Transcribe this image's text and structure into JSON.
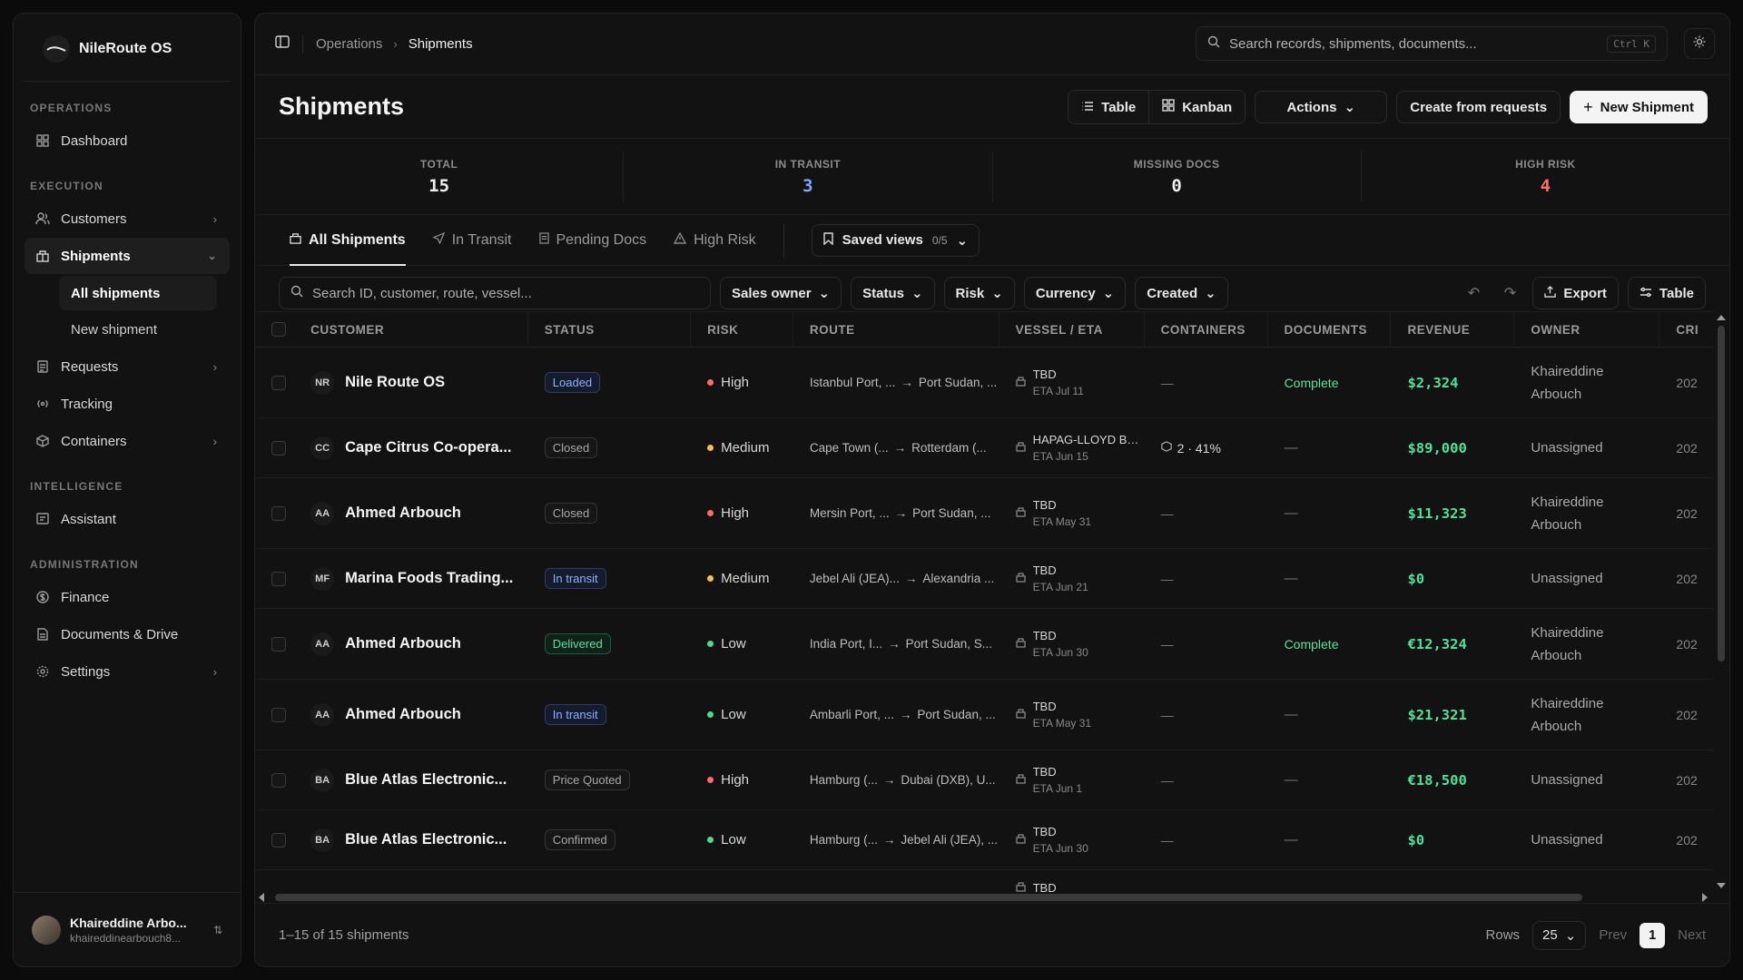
{
  "app": {
    "name": "NileRoute OS"
  },
  "sidebar": {
    "sections": {
      "operations": "OPERATIONS",
      "execution": "EXECUTION",
      "intelligence": "INTELLIGENCE",
      "administration": "ADMINISTRATION"
    },
    "items": {
      "dashboard": "Dashboard",
      "customers": "Customers",
      "shipments": "Shipments",
      "all_shipments": "All shipments",
      "new_shipment": "New shipment",
      "requests": "Requests",
      "tracking": "Tracking",
      "containers": "Containers",
      "assistant": "Assistant",
      "finance": "Finance",
      "documents": "Documents & Drive",
      "settings": "Settings"
    },
    "user": {
      "name": "Khaireddine Arbo...",
      "email": "khaireddinearbouch8..."
    }
  },
  "topbar": {
    "breadcrumb": {
      "parent": "Operations",
      "current": "Shipments"
    },
    "search_placeholder": "Search records, shipments, documents...",
    "shortcut": "Ctrl K"
  },
  "header": {
    "title": "Shipments",
    "view_table": "Table",
    "view_kanban": "Kanban",
    "actions": "Actions",
    "create_from_requests": "Create from requests",
    "new_shipment": "New Shipment"
  },
  "stats": {
    "total": {
      "label": "TOTAL",
      "value": "15"
    },
    "in_transit": {
      "label": "IN TRANSIT",
      "value": "3"
    },
    "missing_docs": {
      "label": "MISSING DOCS",
      "value": "0"
    },
    "high_risk": {
      "label": "HIGH RISK",
      "value": "4"
    }
  },
  "tabs": {
    "all": "All Shipments",
    "in_transit": "In Transit",
    "pending_docs": "Pending Docs",
    "high_risk": "High Risk",
    "saved_views": "Saved views",
    "saved_count": "0/5"
  },
  "filters": {
    "search_placeholder": "Search ID, customer, route, vessel...",
    "sales_owner": "Sales owner",
    "status": "Status",
    "risk": "Risk",
    "currency": "Currency",
    "created": "Created",
    "export": "Export",
    "table": "Table"
  },
  "table": {
    "headers": {
      "customer": "CUSTOMER",
      "status": "STATUS",
      "risk": "RISK",
      "route": "ROUTE",
      "vessel": "VESSEL / ETA",
      "containers": "CONTAINERS",
      "documents": "DOCUMENTS",
      "revenue": "REVENUE",
      "owner": "OWNER",
      "created": "CRI"
    },
    "rows": [
      {
        "initials": "NR",
        "customer": "Nile Route OS",
        "status": "Loaded",
        "status_kind": "loaded",
        "risk": "High",
        "route_from": "Istanbul Port, ...",
        "route_to": "Port Sudan, ...",
        "vessel": "TBD",
        "eta": "ETA Jul 11",
        "containers": "—",
        "documents": "Complete",
        "revenue": "$2,324",
        "owner": "Khaireddine Arbouch",
        "created": "202"
      },
      {
        "initials": "CC",
        "customer": "Cape Citrus Co-opera...",
        "status": "Closed",
        "status_kind": "plain",
        "risk": "Medium",
        "route_from": "Cape Town (...",
        "route_to": "Rotterdam (...",
        "vessel": "HAPAG-LLOYD BE...",
        "eta": "ETA Jun 15",
        "containers": "2 · 41%",
        "documents": "—",
        "revenue": "$89,000",
        "owner": "Unassigned",
        "created": "202"
      },
      {
        "initials": "AA",
        "customer": "Ahmed Arbouch",
        "status": "Closed",
        "status_kind": "plain",
        "risk": "High",
        "route_from": "Mersin Port, ...",
        "route_to": "Port Sudan, ...",
        "vessel": "TBD",
        "eta": "ETA May 31",
        "containers": "—",
        "documents": "—",
        "revenue": "$11,323",
        "owner": "Khaireddine Arbouch",
        "created": "202"
      },
      {
        "initials": "MF",
        "customer": "Marina Foods Trading...",
        "status": "In transit",
        "status_kind": "transit",
        "risk": "Medium",
        "route_from": "Jebel Ali (JEA)...",
        "route_to": "Alexandria ...",
        "vessel": "TBD",
        "eta": "ETA Jun 21",
        "containers": "—",
        "documents": "—",
        "revenue": "$0",
        "owner": "Unassigned",
        "created": "202"
      },
      {
        "initials": "AA",
        "customer": "Ahmed Arbouch",
        "status": "Delivered",
        "status_kind": "delivered",
        "risk": "Low",
        "route_from": "India Port, I...",
        "route_to": "Port Sudan, S...",
        "vessel": "TBD",
        "eta": "ETA Jun 30",
        "containers": "—",
        "documents": "Complete",
        "revenue": "€12,324",
        "owner": "Khaireddine Arbouch",
        "created": "202"
      },
      {
        "initials": "AA",
        "customer": "Ahmed Arbouch",
        "status": "In transit",
        "status_kind": "transit",
        "risk": "Low",
        "route_from": "Ambarli Port, ...",
        "route_to": "Port Sudan, ...",
        "vessel": "TBD",
        "eta": "ETA May 31",
        "containers": "—",
        "documents": "—",
        "revenue": "$21,321",
        "owner": "Khaireddine Arbouch",
        "created": "202"
      },
      {
        "initials": "BA",
        "customer": "Blue Atlas Electronic...",
        "status": "Price Quoted",
        "status_kind": "plain",
        "risk": "High",
        "route_from": "Hamburg (...",
        "route_to": "Dubai (DXB), U...",
        "vessel": "TBD",
        "eta": "ETA Jun 1",
        "containers": "—",
        "documents": "—",
        "revenue": "€18,500",
        "owner": "Unassigned",
        "created": "202"
      },
      {
        "initials": "BA",
        "customer": "Blue Atlas Electronic...",
        "status": "Confirmed",
        "status_kind": "plain",
        "risk": "Low",
        "route_from": "Hamburg (...",
        "route_to": "Jebel Ali (JEA), ...",
        "vessel": "TBD",
        "eta": "ETA Jun 30",
        "containers": "—",
        "documents": "—",
        "revenue": "$0",
        "owner": "Unassigned",
        "created": "202"
      },
      {
        "initials": "",
        "customer": "",
        "status": "",
        "status_kind": "none",
        "risk": "",
        "route_from": "",
        "route_to": "",
        "vessel": "TBD",
        "eta": "",
        "containers": "",
        "documents": "",
        "revenue": "",
        "owner": "",
        "created": ""
      }
    ]
  },
  "footer": {
    "summary": "1–15 of 15 shipments",
    "rows_label": "Rows",
    "rows_value": "25",
    "prev": "Prev",
    "page": "1",
    "next": "Next"
  },
  "colors": {
    "risk_high": "#ff6b6b",
    "risk_medium": "#f2c14e",
    "risk_low": "#4fd88f",
    "in_transit_stat": "#7fa6ff",
    "high_risk_stat": "#ff6b6b",
    "revenue": "#52e09a"
  }
}
